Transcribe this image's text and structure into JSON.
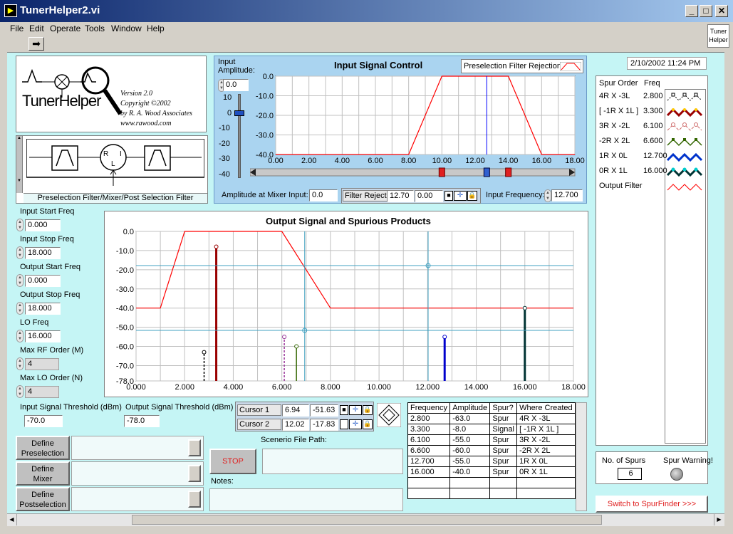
{
  "window": {
    "title": "TunerHelper2.vi",
    "icon": "labview-vi-icon"
  },
  "menu": [
    "File",
    "Edit",
    "Operate",
    "Tools",
    "Window",
    "Help"
  ],
  "toolbar": {
    "run_icon": "run-arrow-icon",
    "tuner_icon_line1": "Tuner",
    "tuner_icon_line2": "Helper"
  },
  "logo": {
    "name": "TunerHelper",
    "version": "Version 2.0",
    "copyright": "Copyright ©2002",
    "author": "by R. A. Wood Associates",
    "url": "www.rawood.com"
  },
  "block_diagram": {
    "caption": "Preselection Filter/Mixer/Post Selection Filter"
  },
  "input_params": [
    {
      "label": "Input Start Freq",
      "value": "0.000"
    },
    {
      "label": "Input Stop Freq",
      "value": "18.000"
    },
    {
      "label": "Output Start Freq",
      "value": "0.000"
    },
    {
      "label": "Output Stop Freq",
      "value": "18.000"
    },
    {
      "label": "LO Freq",
      "value": "16.000"
    },
    {
      "label": "Max RF Order (M)",
      "value": "4"
    },
    {
      "label": "Max LO Order (N)",
      "value": "4"
    }
  ],
  "thresholds": {
    "input_label": "Input Signal Threshold (dBm)",
    "input_value": "-70.0",
    "output_label": "Output Signal Threshold (dBm)",
    "output_value": "-78.0"
  },
  "input_control": {
    "title": "Input Signal Control",
    "amplitude_label_1": "Input",
    "amplitude_label_2": "Amplitude:",
    "amplitude_value": "0.0",
    "legend_label": "Preselection Filter Rejection",
    "slider_ticks": [
      "10",
      "0",
      "-10",
      "-20",
      "-30",
      "-40"
    ],
    "amp_at_mixer_label": "Amplitude at Mixer Input:",
    "amp_at_mixer_value": "0.0",
    "filter_reject_label": "Filter Reject",
    "filter_reject_freq": "12.70",
    "filter_reject_amp": "0.00",
    "input_freq_label": "Input Frequency:",
    "input_freq_value": "12.700"
  },
  "output_control": {
    "title": "Output Signal and Spurious Products",
    "cursor1": {
      "label": "Cursor 1",
      "x": "6.94",
      "y": "-51.63"
    },
    "cursor2": {
      "label": "Cursor 2",
      "x": "12.02",
      "y": "-17.83"
    }
  },
  "chart_data": [
    {
      "type": "line",
      "title": "Input Signal Control",
      "xlim": [
        0,
        18
      ],
      "ylim": [
        -40,
        0
      ],
      "xticks": [
        "0.00",
        "2.00",
        "4.00",
        "6.00",
        "8.00",
        "10.00",
        "12.00",
        "14.00",
        "16.00",
        "18.00"
      ],
      "yticks": [
        "0.0",
        "-10.0",
        "-20.0",
        "-30.0",
        "-40.0"
      ],
      "series": [
        {
          "name": "Preselection Filter Rejection",
          "color": "#ff0000",
          "x": [
            0,
            8,
            10,
            14,
            16,
            18
          ],
          "y": [
            -40,
            -40,
            0,
            0,
            -40,
            -40
          ]
        }
      ],
      "markers": [
        {
          "x": 12.7,
          "color": "#0000ff"
        }
      ]
    },
    {
      "type": "line",
      "title": "Output Signal and Spurious Products",
      "xlim": [
        0,
        18
      ],
      "ylim": [
        -78,
        0
      ],
      "xticks": [
        "0.000",
        "2.000",
        "4.000",
        "6.000",
        "8.000",
        "10.000",
        "12.000",
        "14.000",
        "16.000",
        "18.000"
      ],
      "yticks": [
        "0.0",
        "-10.0",
        "-20.0",
        "-30.0",
        "-40.0",
        "-50.0",
        "-60.0",
        "-70.0",
        "-78.0"
      ],
      "series": [
        {
          "name": "Output Filter",
          "color": "#ff0000",
          "x": [
            0,
            1,
            2,
            6,
            8,
            18
          ],
          "y": [
            -40,
            -40,
            0,
            0,
            -40,
            -40
          ]
        }
      ],
      "spurs": [
        {
          "x": 2.8,
          "y": -63.0,
          "color": "#000000",
          "style": "dashed"
        },
        {
          "x": 3.3,
          "y": -8.0,
          "color": "#990000",
          "style": "thick"
        },
        {
          "x": 6.1,
          "y": -55.0,
          "color": "#993399",
          "style": "dashed"
        },
        {
          "x": 6.6,
          "y": -60.0,
          "color": "#336600",
          "style": "solid"
        },
        {
          "x": 12.7,
          "y": -55.0,
          "color": "#0000cc",
          "style": "thick"
        },
        {
          "x": 16.0,
          "y": -40.0,
          "color": "#003333",
          "style": "thick"
        }
      ],
      "cursors": [
        {
          "x": 6.94,
          "y": -51.63
        },
        {
          "x": 12.02,
          "y": -17.83
        }
      ]
    }
  ],
  "spur_table": {
    "headers": [
      "Frequency",
      "Amplitude",
      "Spur?",
      "Where Created"
    ],
    "rows": [
      [
        "2.800",
        "-63.0",
        "Spur",
        "4R X -3L"
      ],
      [
        "3.300",
        "-8.0",
        "Signal",
        "[ -1R X 1L ]"
      ],
      [
        "6.100",
        "-55.0",
        "Spur",
        "3R X -2L"
      ],
      [
        "6.600",
        "-60.0",
        "Spur",
        "-2R X 2L"
      ],
      [
        "12.700",
        "-55.0",
        "Spur",
        "1R X 0L"
      ],
      [
        "16.000",
        "-40.0",
        "Spur",
        "0R X 1L"
      ]
    ]
  },
  "define_buttons": [
    {
      "label1": "Define",
      "label2": "Preselection"
    },
    {
      "label1": "Define",
      "label2": "Mixer"
    },
    {
      "label1": "Define",
      "label2": "Postselection"
    }
  ],
  "stop_label": "STOP",
  "scenario_label": "Scenerio File Path:",
  "notes_label": "Notes:",
  "datetime": "2/10/2002 11:24 PM",
  "spur_legend": {
    "header_order": "Spur Order",
    "header_freq": "Freq",
    "items": [
      {
        "order": "4R X -3L",
        "freq": "2.800",
        "color": "#000000"
      },
      {
        "order": "[ -1R X 1L ]",
        "freq": "3.300",
        "color": "#990000"
      },
      {
        "order": "3R X -2L",
        "freq": "6.100",
        "color": "#cc6666"
      },
      {
        "order": "-2R X 2L",
        "freq": "6.600",
        "color": "#336600"
      },
      {
        "order": "1R X 0L",
        "freq": "12.700",
        "color": "#0033cc"
      },
      {
        "order": "0R X 1L",
        "freq": "16.000",
        "color": "#003333"
      },
      {
        "order": "Output Filter",
        "freq": "",
        "color": "#ff0000"
      }
    ]
  },
  "spur_count": {
    "label": "No. of Spurs",
    "value": "6",
    "warning_label": "Spur Warning!"
  },
  "switch_button": "Switch to SpurFinder >>>"
}
